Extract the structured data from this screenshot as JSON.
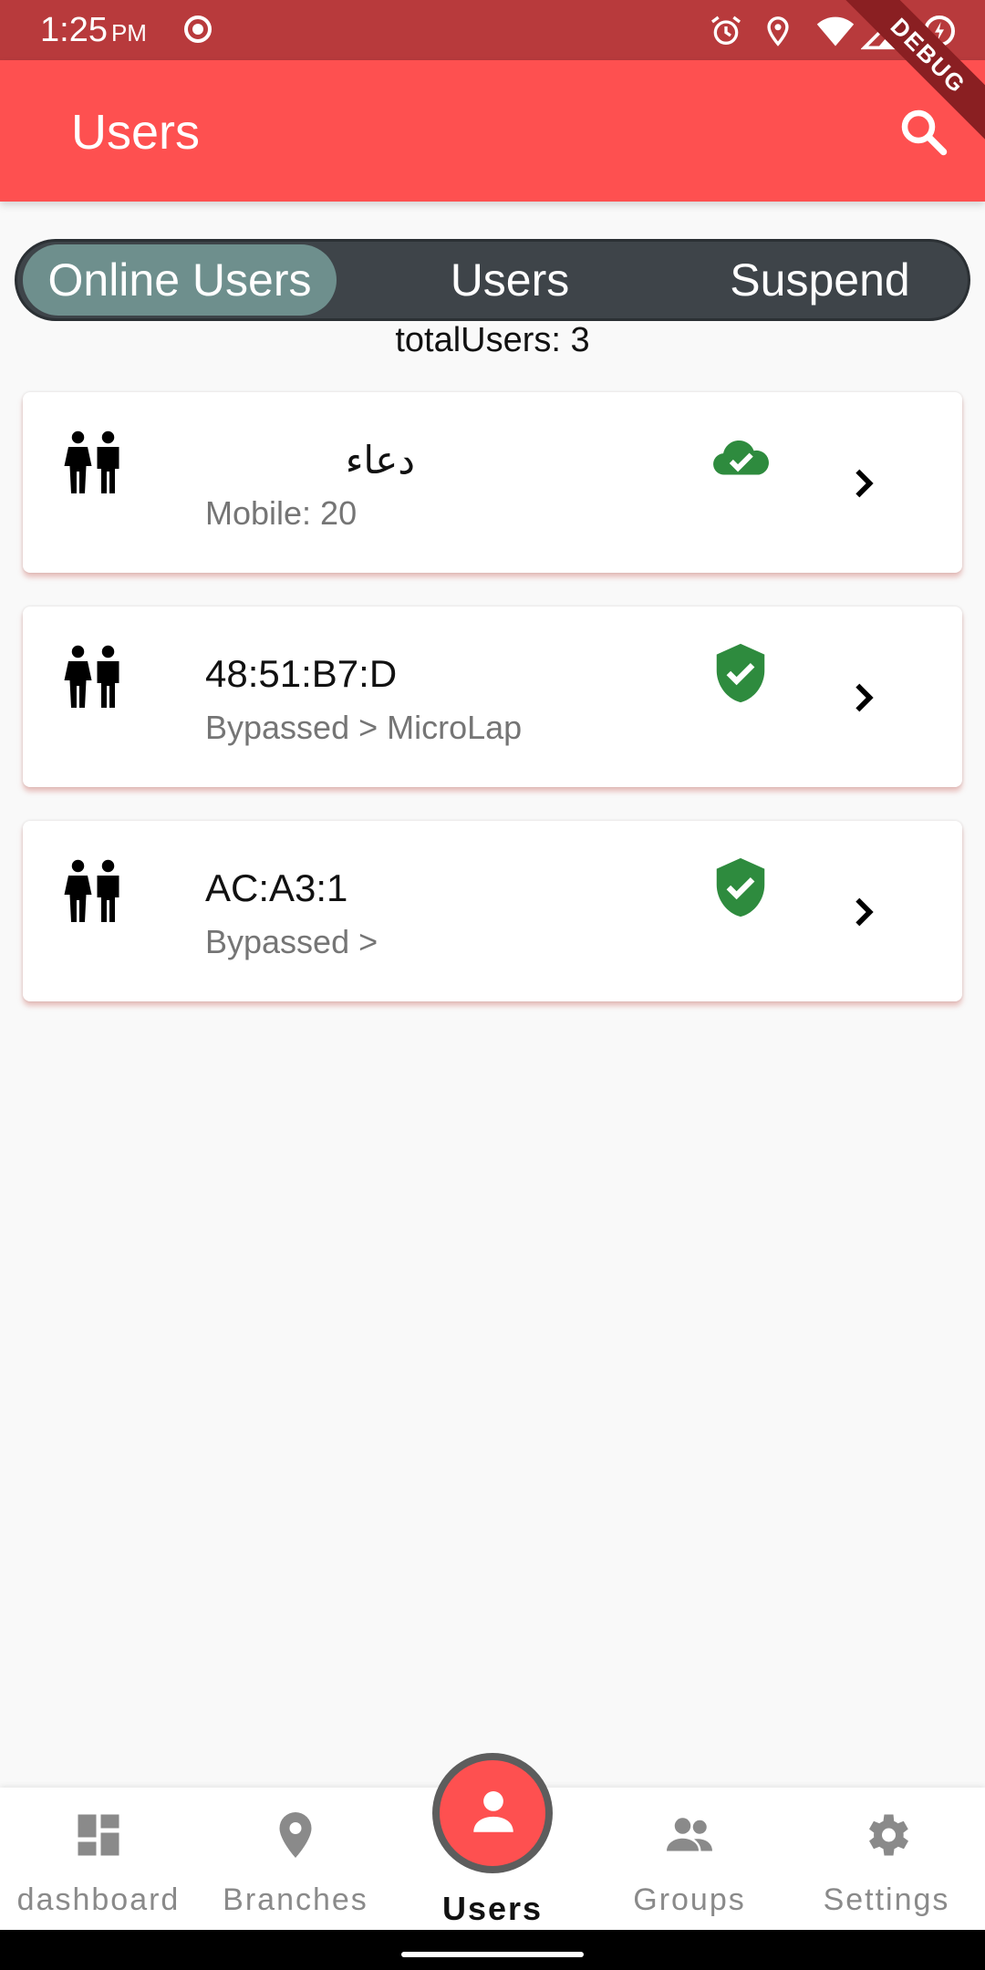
{
  "status_bar": {
    "time": "1:25",
    "ampm": "PM"
  },
  "debug_ribbon": "DEBUG",
  "app_bar": {
    "title": "Users"
  },
  "tabs": [
    {
      "label": "Online Users",
      "active": true
    },
    {
      "label": "Users",
      "active": false
    },
    {
      "label": "Suspend",
      "active": false
    }
  ],
  "total_users": "totalUsers: 3",
  "users": [
    {
      "name": "دعاء",
      "subtitle": "Mobile: 20",
      "status_icon": "cloud-check-icon"
    },
    {
      "name": "48:51:B7:D",
      "subtitle": "Bypassed > MicroLap",
      "status_icon": "shield-check-icon"
    },
    {
      "name": "AC:A3:1",
      "subtitle": "Bypassed >",
      "status_icon": "shield-check-icon"
    }
  ],
  "bottom_nav": [
    {
      "label": "dashboard",
      "icon": "dashboard-icon"
    },
    {
      "label": "Branches",
      "icon": "location-pin-icon"
    },
    {
      "label": "Users",
      "icon": "person-icon",
      "active": true
    },
    {
      "label": "Groups",
      "icon": "groups-icon"
    },
    {
      "label": "Settings",
      "icon": "gear-icon"
    }
  ],
  "colors": {
    "status_bar": "#b83a3c",
    "app_bar": "#fe5050",
    "tab_background": "#3e4449",
    "tab_active": "#6e8f8d",
    "status_green": "#2e8b3e"
  }
}
